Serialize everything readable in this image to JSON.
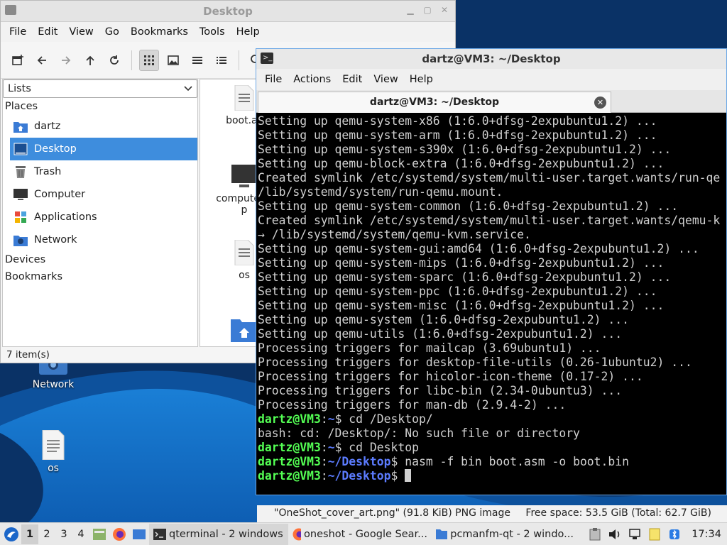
{
  "desktop": {
    "icons": [
      {
        "label": "Network"
      },
      {
        "label": "os"
      }
    ]
  },
  "file_manager": {
    "title": "Desktop",
    "menu": [
      "File",
      "Edit",
      "View",
      "Go",
      "Bookmarks",
      "Tools",
      "Help"
    ],
    "sidebar_mode": "Lists",
    "places_header": "Places",
    "places": [
      {
        "label": "dartz",
        "icon": "home-folder-icon"
      },
      {
        "label": "Desktop",
        "icon": "desktop-folder-icon",
        "selected": true
      },
      {
        "label": "Trash",
        "icon": "trash-icon"
      },
      {
        "label": "Computer",
        "icon": "computer-icon"
      },
      {
        "label": "Applications",
        "icon": "applications-icon"
      },
      {
        "label": "Network",
        "icon": "network-icon"
      }
    ],
    "devices_header": "Devices",
    "bookmarks_header": "Bookmarks",
    "files": [
      {
        "label": "boot.as"
      },
      {
        "label": "computer.d"
      },
      {
        "label": "p"
      },
      {
        "label": "os"
      }
    ],
    "status": "7 item(s)",
    "status_file": "\"OneShot_cover_art.png\" (91.8 KiB) PNG image",
    "status_space": "Free space: 53.5 GiB (Total: 62.7 GiB)"
  },
  "terminal": {
    "title": "dartz@VM3: ~/Desktop",
    "menu": [
      "File",
      "Actions",
      "Edit",
      "View",
      "Help"
    ],
    "tab_title": "dartz@VM3: ~/Desktop",
    "output": [
      "Setting up qemu-system-x86 (1:6.0+dfsg-2expubuntu1.2) ...",
      "Setting up qemu-system-arm (1:6.0+dfsg-2expubuntu1.2) ...",
      "Setting up qemu-system-s390x (1:6.0+dfsg-2expubuntu1.2) ...",
      "Setting up qemu-block-extra (1:6.0+dfsg-2expubuntu1.2) ...",
      "Created symlink /etc/systemd/system/multi-user.target.wants/run-qe",
      "/lib/systemd/system/run-qemu.mount.",
      "Setting up qemu-system-common (1:6.0+dfsg-2expubuntu1.2) ...",
      "Created symlink /etc/systemd/system/multi-user.target.wants/qemu-k",
      "→ /lib/systemd/system/qemu-kvm.service.",
      "Setting up qemu-system-gui:amd64 (1:6.0+dfsg-2expubuntu1.2) ...",
      "Setting up qemu-system-mips (1:6.0+dfsg-2expubuntu1.2) ...",
      "Setting up qemu-system-sparc (1:6.0+dfsg-2expubuntu1.2) ...",
      "Setting up qemu-system-ppc (1:6.0+dfsg-2expubuntu1.2) ...",
      "Setting up qemu-system-misc (1:6.0+dfsg-2expubuntu1.2) ...",
      "Setting up qemu-system (1:6.0+dfsg-2expubuntu1.2) ...",
      "Setting up qemu-utils (1:6.0+dfsg-2expubuntu1.2) ...",
      "Processing triggers for mailcap (3.69ubuntu1) ...",
      "Processing triggers for desktop-file-utils (0.26-1ubuntu2) ...",
      "Processing triggers for hicolor-icon-theme (0.17-2) ...",
      "Processing triggers for libc-bin (2.34-0ubuntu3) ...",
      "Processing triggers for man-db (2.9.4-2) ..."
    ],
    "prompt_user": "dartz@VM3",
    "commands": [
      {
        "path": "~",
        "cmd": " cd /Desktop/"
      },
      {
        "output": "bash: cd: /Desktop/: No such file or directory"
      },
      {
        "path": "~",
        "cmd": " cd Desktop"
      },
      {
        "path": "~/Desktop",
        "cmd": " nasm -f bin boot.asm -o boot.bin"
      },
      {
        "path": "~/Desktop",
        "cmd": " "
      }
    ]
  },
  "taskbar": {
    "workspaces": [
      "1",
      "2",
      "3",
      "4"
    ],
    "tasks": [
      {
        "label": "qterminal - 2 windows",
        "icon": "terminal-icon"
      },
      {
        "label": "oneshot - Google Sear...",
        "icon": "firefox-icon"
      },
      {
        "label": "pcmanfm-qt - 2 windo...",
        "icon": "folder-icon"
      }
    ],
    "clock": "17:34"
  }
}
